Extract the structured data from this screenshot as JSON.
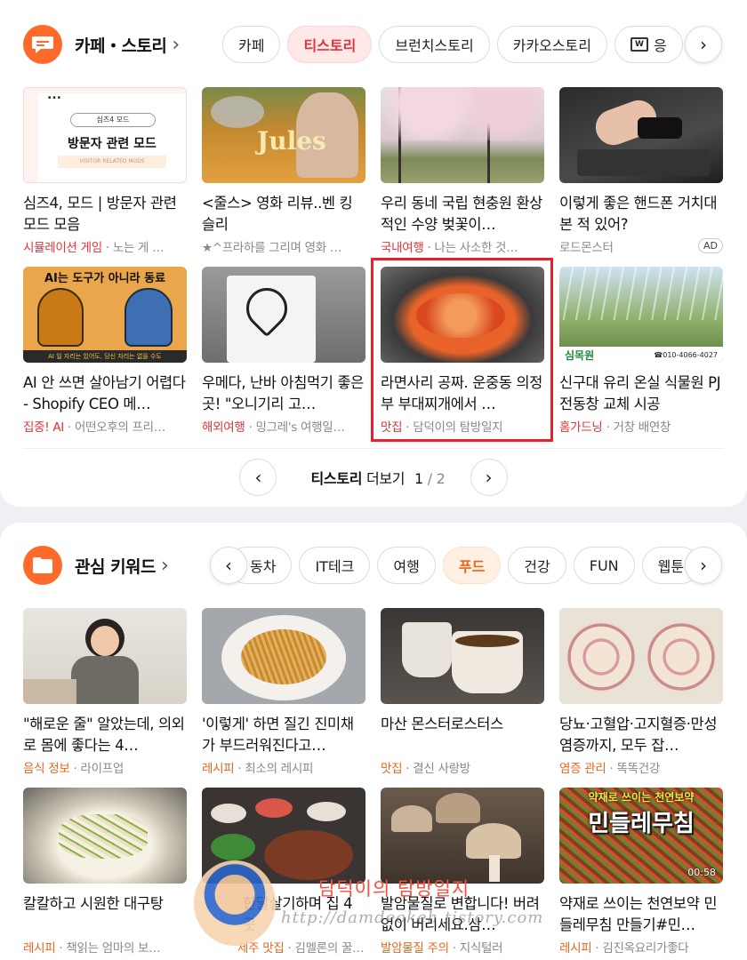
{
  "section1": {
    "title": "카페・스토리",
    "chevron": "›",
    "chips": [
      "카페",
      "티스토리",
      "브런치스토리",
      "카카오스토리",
      "응"
    ],
    "active_chip": 1,
    "items": [
      {
        "title": "심즈4, 모드 | 방문자 관련 모드 모음",
        "category": "시뮬레이션 게임",
        "source": "노는 게 …",
        "thumb_text": "방문자 관련 모드",
        "thumb_sub": "VISITOR RELATED MODS",
        "thumb_search": "심즈4 모드",
        "thumb_dots": "...",
        "ad": ""
      },
      {
        "title": "<줄스> 영화 리뷰..벤 킹슬리",
        "category": "",
        "source": "★^프라하를 그리며 영화 …",
        "thumb_text": "Jules",
        "ad": ""
      },
      {
        "title": "우리 동네 국립 현충원 환상적인 수양 벚꽃이…",
        "category": "국내여행",
        "source": "나는 사소한 것…",
        "ad": ""
      },
      {
        "title": "이렇게 좋은 핸드폰 거치대 본 적 있어?",
        "category": "",
        "source": "로드몬스터",
        "ad": "AD"
      },
      {
        "title": "AI 안 쓰면 살아남기 어렵다 - Shopify CEO 메…",
        "category": "집중! AI",
        "source": "어떤오후의 프리…",
        "thumb_text": "AI는 도구가 아니라 동료",
        "thumb_sub": "AI 일 자리는 있어도, 당신 자리는 없을 수도",
        "ad": ""
      },
      {
        "title": "우메다, 난바 아침먹기 좋은 곳! \"오니기리 고…",
        "category": "해외여행",
        "source": "밍그레's 여행일…",
        "ad": ""
      },
      {
        "title": "라면사리 공짜. 운중동 의정부 부대찌개에서 …",
        "category": "맛집",
        "source": "담덕이의 탐방일지",
        "ad": ""
      },
      {
        "title": "신구대 유리 온실 식물원 PJ전동창 교체 시공",
        "category": "홈가드닝",
        "source": "거창 배연창",
        "thumb_text": "심목원",
        "thumb_sub": "☎010-4066-4027",
        "ad": ""
      }
    ],
    "pager": {
      "label": "티스토리",
      "more": "더보기",
      "current": "1",
      "sep": "/",
      "total": "2"
    }
  },
  "section2": {
    "title": "관심 키워드",
    "chevron": "›",
    "chips": [
      "동차",
      "IT테크",
      "여행",
      "푸드",
      "건강",
      "FUN",
      "웹툰"
    ],
    "active_chip": 3,
    "items": [
      {
        "title": "\"해로운 줄\" 알았는데, 의외로 몸에 좋다는 4…",
        "category": "음식 정보",
        "source": "라이프업"
      },
      {
        "title": "'이렇게' 하면 질긴 진미채가 부드러워진다고…",
        "category": "레시피",
        "source": "최소의 레시피"
      },
      {
        "title": "마산 몬스터로스터스",
        "category": "맛집",
        "source": "결신 사랑방"
      },
      {
        "title": "당뇨·고혈압·고지혈증·만성염증까지, 모두 잡…",
        "category": "염증 관리",
        "source": "똑똑건강"
      },
      {
        "title": "칼칼하고 시원한 대구탕",
        "category": "레시피",
        "source": "책읽는 엄마의 보…"
      },
      {
        "title": "한달살기하며 집 4곳",
        "category": "제주 맛집",
        "source": "김멜론의 꿀…"
      },
      {
        "title": "발암물질로 변합니다! 버려없이 버리세요.삼…",
        "category": "발암물질 주의",
        "source": "지식털러"
      },
      {
        "title": "약재로 쓰이는 천연보약 민들레무침 만들기#민…",
        "category": "레시피",
        "source": "김진옥요리가좋다",
        "thumb_text": "민들레무침",
        "thumb_sub": "약재로 쓰이는 천연보약",
        "duration": "00:58"
      }
    ]
  },
  "watermark": {
    "name": "담덕이의 탐방일지",
    "url": "http://damdeokeh.tistory.com"
  },
  "colors": {
    "accent_red": "#e0343a",
    "accent_orange": "#e8661b",
    "icon_orange": "#ff6a2b",
    "highlight": "#e8202a"
  },
  "icons": {
    "section1": "chat-bubble-icon",
    "section2": "folder-icon",
    "prev": "chevron-left-icon",
    "next": "chevron-right-icon"
  }
}
